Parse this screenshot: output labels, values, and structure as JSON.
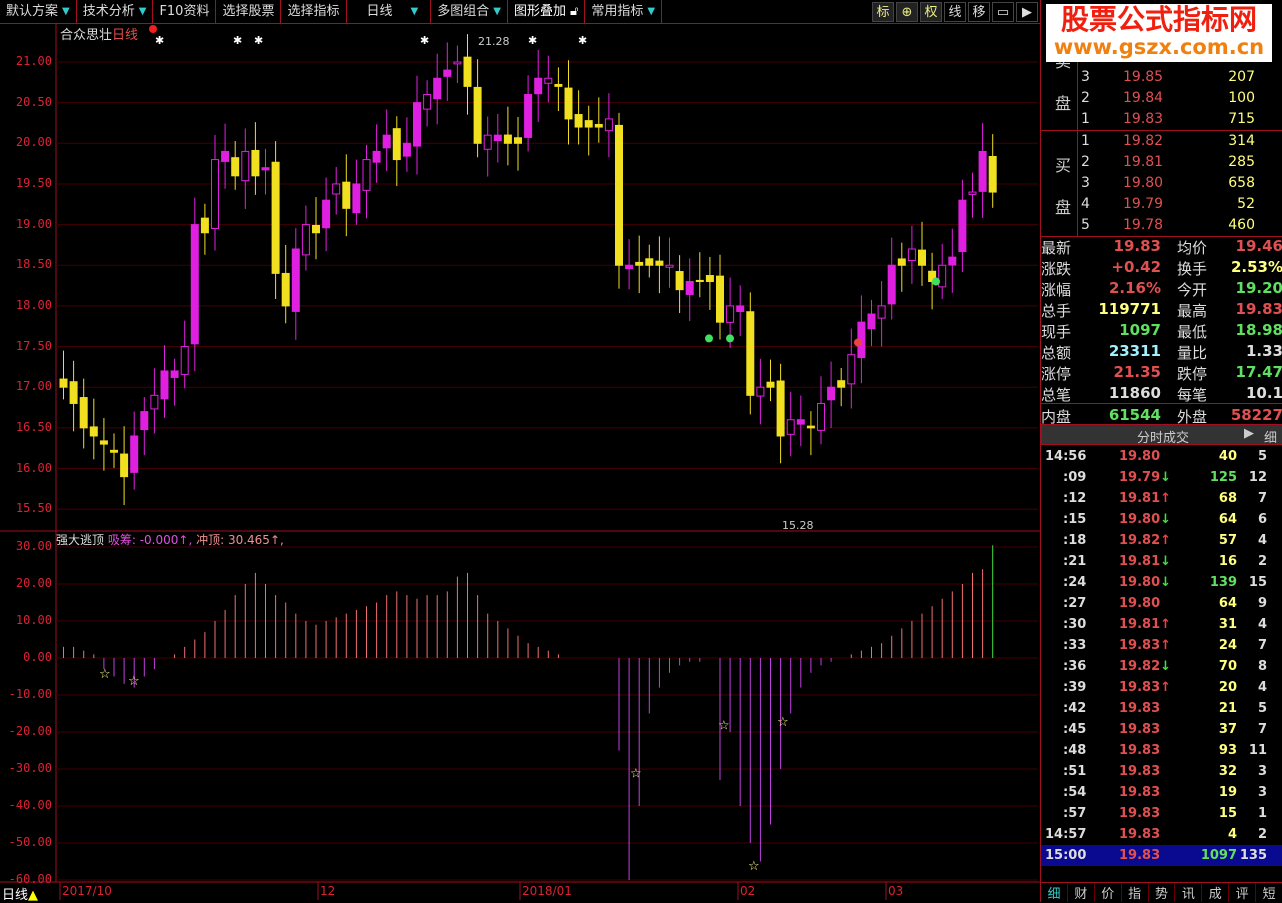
{
  "toolbar": {
    "items": [
      "默认方案",
      "技术分析",
      "F10资料",
      "选择股票",
      "选择指标",
      "日线",
      "多图组合",
      "图形叠加",
      "常用指标"
    ],
    "right_icons": [
      "标",
      "⊕",
      "权",
      "线",
      "移",
      "▭",
      "▶"
    ]
  },
  "main_panel": {
    "title": "合众思壮",
    "period": "日线",
    "high_label": "21.28",
    "low_label": "15.28",
    "y_ticks": [
      "21.00",
      "20.50",
      "20.00",
      "19.50",
      "19.00",
      "18.50",
      "18.00",
      "17.50",
      "17.00",
      "16.50",
      "16.00",
      "15.50"
    ]
  },
  "indicator": {
    "name": "强大逃顶",
    "line1": "吸筹: -0.000↑,",
    "line2": "冲顶: 30.465↑,",
    "y_ticks": [
      "30.00",
      "20.00",
      "10.00",
      "0.00",
      "-10.00",
      "-20.00",
      "-30.00",
      "-40.00",
      "-50.00",
      "-60.00"
    ]
  },
  "date_axis": {
    "period": "日线",
    "labels": [
      "2017/10",
      "12",
      "2018/01",
      "02",
      "03"
    ]
  },
  "candles": {
    "closes": [
      17.0,
      16.8,
      16.5,
      16.4,
      16.3,
      16.2,
      15.9,
      16.4,
      16.7,
      16.9,
      17.2,
      17.2,
      17.5,
      19.0,
      18.9,
      19.8,
      19.9,
      19.6,
      19.9,
      19.6,
      19.7,
      18.4,
      18.0,
      18.7,
      19.0,
      18.9,
      19.3,
      19.5,
      19.2,
      19.5,
      19.8,
      19.9,
      20.1,
      19.8,
      20.0,
      20.5,
      20.6,
      20.8,
      20.9,
      21.0,
      20.7,
      20.0,
      20.1,
      20.1,
      20.0,
      20.0,
      20.6,
      20.8,
      20.8,
      20.7,
      20.3,
      20.2,
      20.2,
      20.2,
      20.3,
      18.5,
      18.5,
      18.5,
      18.5,
      18.5,
      18.5,
      18.2,
      18.3,
      18.3,
      18.3,
      17.8,
      18.0,
      18.0,
      16.9,
      17.0,
      17.0,
      16.4,
      16.6,
      16.6,
      16.5,
      16.8,
      17.0,
      17.0,
      17.4,
      17.8,
      17.9,
      18.0,
      18.5,
      18.5,
      18.7,
      18.5,
      18.3,
      18.5,
      18.6,
      19.3,
      19.4,
      19.9,
      19.4
    ],
    "indicator_values": [
      3,
      3,
      2,
      1,
      -3,
      -5,
      -7,
      -8,
      -5,
      -3,
      0,
      1,
      3,
      5,
      7,
      10,
      13,
      17,
      20,
      23,
      20,
      17,
      15,
      12,
      10,
      9,
      10,
      11,
      12,
      13,
      14,
      15,
      17,
      18,
      17,
      16,
      17,
      17,
      18,
      22,
      23,
      17,
      12,
      10,
      8,
      6,
      4,
      3,
      2,
      1,
      0,
      0,
      0,
      0,
      0,
      -25,
      -60,
      -40,
      -15,
      -8,
      -4,
      -2,
      -1,
      -1,
      0,
      -33,
      -20,
      -40,
      -50,
      -55,
      -45,
      -30,
      -15,
      -8,
      -4,
      -2,
      -1,
      0,
      1,
      2,
      3,
      4,
      6,
      8,
      10,
      12,
      14,
      16,
      18,
      20,
      23,
      24,
      30.465
    ]
  },
  "order_book": {
    "sell_label": "卖盘",
    "buy_label": "买盘",
    "sell": [
      {
        "lvl": "3",
        "price": "19.85",
        "vol": "207"
      },
      {
        "lvl": "2",
        "price": "19.84",
        "vol": "100"
      },
      {
        "lvl": "1",
        "price": "19.83",
        "vol": "715"
      }
    ],
    "buy": [
      {
        "lvl": "1",
        "price": "19.82",
        "vol": "314"
      },
      {
        "lvl": "2",
        "price": "19.81",
        "vol": "285"
      },
      {
        "lvl": "3",
        "price": "19.80",
        "vol": "658"
      },
      {
        "lvl": "4",
        "price": "19.79",
        "vol": "52"
      },
      {
        "lvl": "5",
        "price": "19.78",
        "vol": "460"
      }
    ]
  },
  "stats": [
    [
      "最新",
      "19.83",
      "red",
      "均价",
      "19.46",
      "red"
    ],
    [
      "涨跌",
      "+0.42",
      "red",
      "换手",
      "2.53%",
      "yel"
    ],
    [
      "涨幅",
      "2.16%",
      "red",
      "今开",
      "19.20",
      "grn"
    ],
    [
      "总手",
      "119771",
      "yel",
      "最高",
      "19.83",
      "red"
    ],
    [
      "现手",
      "1097",
      "grn",
      "最低",
      "18.98",
      "grn"
    ],
    [
      "总额",
      "23311",
      "cy",
      "量比",
      "1.33",
      "wh"
    ],
    [
      "涨停",
      "21.35",
      "red",
      "跌停",
      "17.47",
      "grn"
    ],
    [
      "总笔",
      "11860",
      "wh",
      "每笔",
      "10.1",
      "wh"
    ],
    [
      "内盘",
      "61544",
      "grn",
      "外盘",
      "58227",
      "red"
    ]
  ],
  "ticks_header": {
    "title": "分时成交",
    "detail": "细"
  },
  "ticks": [
    [
      "14:56",
      "19.80",
      "",
      "40",
      "5"
    ],
    [
      ":09",
      "19.79",
      "down",
      "125",
      "12"
    ],
    [
      ":12",
      "19.81",
      "up",
      "68",
      "7"
    ],
    [
      ":15",
      "19.80",
      "down",
      "64",
      "6"
    ],
    [
      ":18",
      "19.82",
      "up",
      "57",
      "4"
    ],
    [
      ":21",
      "19.81",
      "down",
      "16",
      "2"
    ],
    [
      ":24",
      "19.80",
      "down",
      "139",
      "15"
    ],
    [
      ":27",
      "19.80",
      "",
      "64",
      "9"
    ],
    [
      ":30",
      "19.81",
      "up",
      "31",
      "4"
    ],
    [
      ":33",
      "19.83",
      "up",
      "24",
      "7"
    ],
    [
      ":36",
      "19.82",
      "down",
      "70",
      "8"
    ],
    [
      ":39",
      "19.83",
      "up",
      "20",
      "4"
    ],
    [
      ":42",
      "19.83",
      "",
      "21",
      "5"
    ],
    [
      ":45",
      "19.83",
      "",
      "37",
      "7"
    ],
    [
      ":48",
      "19.83",
      "",
      "93",
      "11"
    ],
    [
      ":51",
      "19.83",
      "",
      "32",
      "3"
    ],
    [
      ":54",
      "19.83",
      "",
      "19",
      "3"
    ],
    [
      ":57",
      "19.83",
      "",
      "15",
      "1"
    ],
    [
      "14:57",
      "19.83",
      "",
      "4",
      "2"
    ],
    [
      "15:00",
      "19.83",
      "",
      "1097",
      "135"
    ]
  ],
  "bottom_tabs": [
    "细",
    "财",
    "价",
    "指",
    "势",
    "讯",
    "成",
    "评",
    "短"
  ],
  "watermark": {
    "line1": "股票公式指标网",
    "line2": "www.gszx.com.cn"
  }
}
